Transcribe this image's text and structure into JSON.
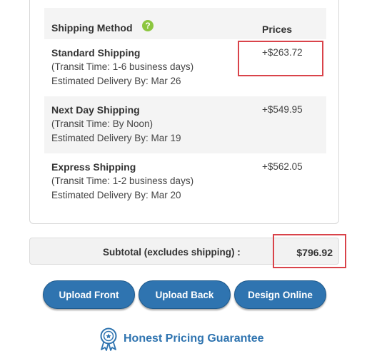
{
  "shipping": {
    "header_method": "Shipping Method",
    "header_prices": "Prices",
    "help_glyph": "?",
    "options": [
      {
        "name": "Standard Shipping",
        "transit": "(Transit Time: 1-6 business days)",
        "eta": "Estimated Delivery By: Mar 26",
        "price": "+$263.72"
      },
      {
        "name": "Next Day Shipping",
        "transit": "(Transit Time: By Noon)",
        "eta": "Estimated Delivery By: Mar 19",
        "price": "+$549.95"
      },
      {
        "name": "Express Shipping",
        "transit": "(Transit Time: 1-2 business days)",
        "eta": "Estimated Delivery By: Mar 20",
        "price": "+$562.05"
      }
    ]
  },
  "subtotal": {
    "label": "Subtotal (excludes shipping) :",
    "value": "$796.92"
  },
  "actions": {
    "upload_front": "Upload Front",
    "upload_back": "Upload Back",
    "design_online": "Design Online"
  },
  "guarantee": {
    "label": "Honest Pricing Guarantee",
    "icon": "award-ribbon-icon"
  },
  "colors": {
    "accent": "#2f74b0",
    "highlight": "#d9434a",
    "help_icon": "#8cc63f"
  }
}
